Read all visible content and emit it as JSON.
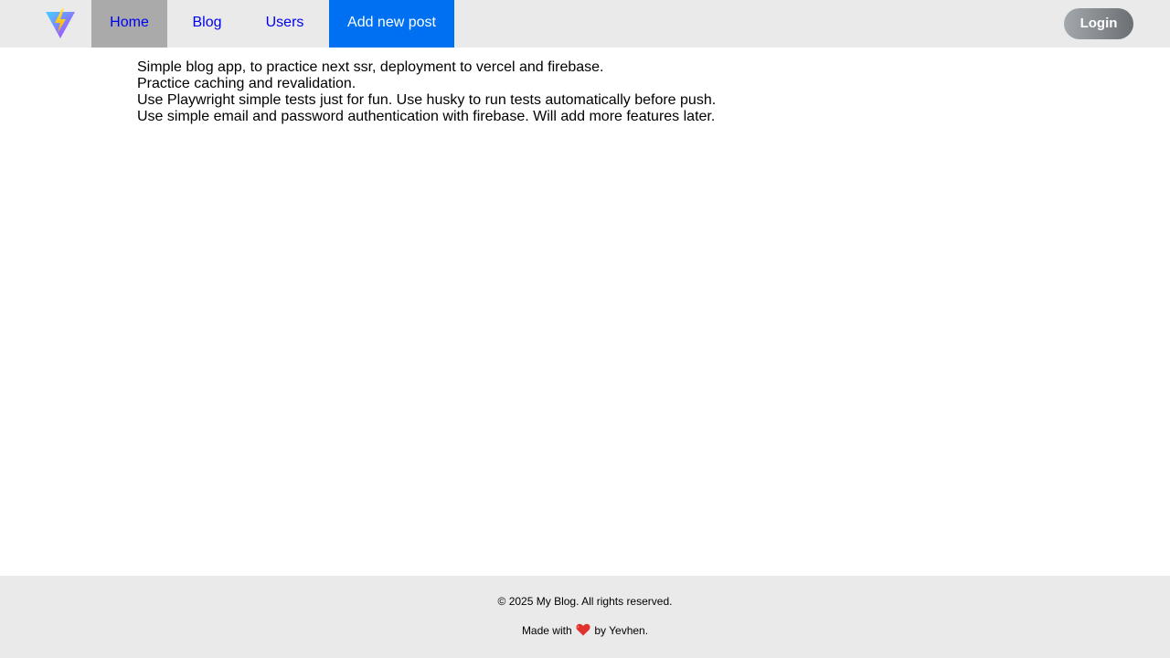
{
  "nav": {
    "logo_icon": "vite-lightning-logo-icon",
    "links": [
      {
        "label": "Home",
        "active": true
      },
      {
        "label": "Blog"
      },
      {
        "label": "Users"
      },
      {
        "label": "Add new post",
        "highlight_color": "#0070f3"
      }
    ],
    "login_label": "Login"
  },
  "main": {
    "lines": [
      "Simple blog app, to practice next ssr, deployment to vercel and firebase.",
      "Practice caching and revalidation.",
      "Use Playwright simple tests just for fun. Use husky to run tests automatically before push.",
      "Use simple email and password authentication with firebase. Will add more features later."
    ]
  },
  "footer": {
    "copyright": "© 2025 My Blog. All rights reserved.",
    "made_with_prefix": "Made with",
    "made_with_icon": "heart-icon",
    "made_with_suffix": "by Yevhen."
  }
}
